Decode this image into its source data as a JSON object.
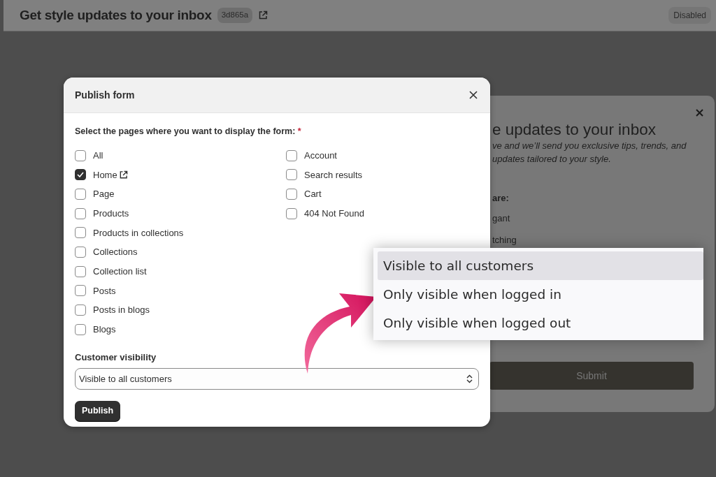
{
  "header": {
    "title": "Get style updates to your inbox",
    "id_badge": "3d865a",
    "status": "Disabled"
  },
  "preview": {
    "heading": "e updates to your inbox",
    "text_lines": [
      "ve and we’ll send you exclusive tips, trends, and",
      "updates tailored to your style."
    ],
    "question": "are:",
    "options": [
      "gant",
      "tching"
    ],
    "submit": "Submit"
  },
  "modal": {
    "title": "Publish form",
    "pages_label": "Select the pages where you want to display the form:",
    "required_mark": "*",
    "page_columns": [
      [
        {
          "label": "All",
          "checked": false
        },
        {
          "label": "Home",
          "checked": true,
          "external_link": true
        },
        {
          "label": "Page",
          "checked": false
        },
        {
          "label": "Products",
          "checked": false
        },
        {
          "label": "Products in collections",
          "checked": false
        },
        {
          "label": "Collections",
          "checked": false
        },
        {
          "label": "Collection list",
          "checked": false
        },
        {
          "label": "Posts",
          "checked": false
        },
        {
          "label": "Posts in blogs",
          "checked": false
        },
        {
          "label": "Blogs",
          "checked": false
        }
      ],
      [
        {
          "label": "Account",
          "checked": false
        },
        {
          "label": "Search results",
          "checked": false
        },
        {
          "label": "Cart",
          "checked": false
        },
        {
          "label": "404 Not Found",
          "checked": false
        }
      ]
    ],
    "visibility_label": "Customer visibility",
    "visibility_value": "Visible to all customers",
    "publish": "Publish"
  },
  "dropdown": {
    "options": [
      {
        "label": "Visible to all customers",
        "selected": true
      },
      {
        "label": "Only visible when logged in",
        "selected": false
      },
      {
        "label": "Only visible when logged out",
        "selected": false
      }
    ]
  }
}
